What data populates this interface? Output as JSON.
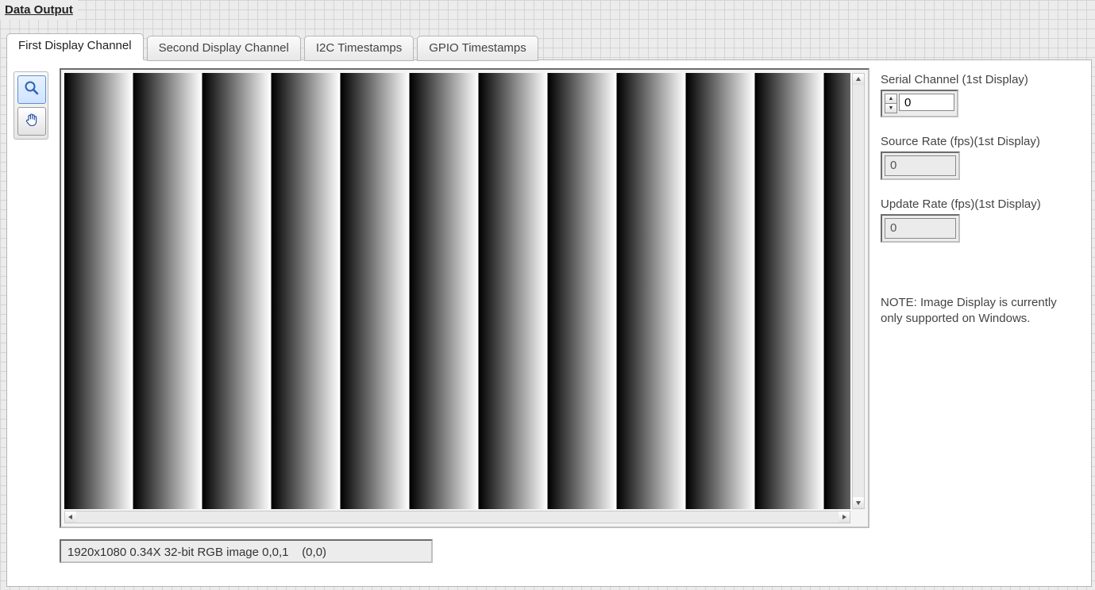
{
  "panel": {
    "title": "Data Output"
  },
  "tabs": [
    {
      "label": "First Display Channel",
      "active": true
    },
    {
      "label": "Second Display Channel",
      "active": false
    },
    {
      "label": "I2C Timestamps",
      "active": false
    },
    {
      "label": "GPIO Timestamps",
      "active": false
    }
  ],
  "tools": {
    "zoom_icon": "zoom-icon",
    "pan_icon": "hand-icon"
  },
  "image_status": "1920x1080 0.34X 32-bit RGB image 0,0,1    (0,0)",
  "props": {
    "serial_channel": {
      "label": "Serial Channel (1st Display)",
      "value": "0"
    },
    "source_rate": {
      "label": "Source Rate (fps)(1st Display)",
      "value": "0"
    },
    "update_rate": {
      "label": "Update Rate (fps)(1st Display)",
      "value": "0"
    }
  },
  "note": "NOTE: Image Display is currently only supported on Windows."
}
